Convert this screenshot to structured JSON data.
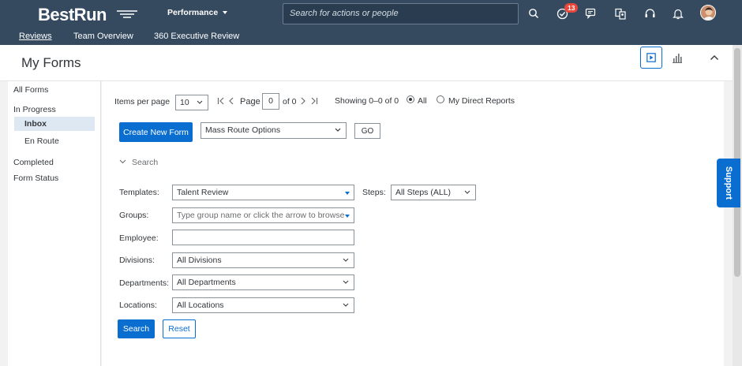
{
  "shell": {
    "logo": "BestRun",
    "menu_title": "Performance",
    "search_placeholder": "Search for actions or people",
    "notification_count": "13",
    "nav": [
      "Reviews",
      "Team Overview",
      "360 Executive Review"
    ]
  },
  "page": {
    "title": "My Forms"
  },
  "leftnav": {
    "all_forms": "All Forms",
    "in_progress": "In Progress",
    "inbox": "Inbox",
    "en_route": "En Route",
    "completed": "Completed",
    "form_status": "Form Status"
  },
  "pagination": {
    "items_per_page_label": "Items per page",
    "items_per_page": "10",
    "page_label": "Page",
    "page_value": "0",
    "of_label": "of 0",
    "showing": "Showing 0–0 of 0",
    "radio_all": "All",
    "radio_direct": "My Direct Reports"
  },
  "actions": {
    "create_new_form": "Create New Form",
    "mass_route": "Mass Route Options",
    "go": "GO"
  },
  "search": {
    "section_label": "Search",
    "templates_label": "Templates:",
    "templates_value": "Talent Review",
    "steps_label": "Steps:",
    "steps_value": "All Steps (ALL)",
    "groups_label": "Groups:",
    "groups_placeholder": "Type group name or click the arrow to browse",
    "employee_label": "Employee:",
    "employee_value": "",
    "divisions_label": "Divisions:",
    "divisions_value": "All Divisions",
    "departments_label": "Departments:",
    "departments_value": "All Departments",
    "locations_label": "Locations:",
    "locations_value": "All Locations",
    "search_button": "Search",
    "reset_button": "Reset"
  },
  "support": "Support",
  "colors": {
    "shell": "#354a5f",
    "accent": "#0a6ed1",
    "badge": "#e9463a"
  }
}
